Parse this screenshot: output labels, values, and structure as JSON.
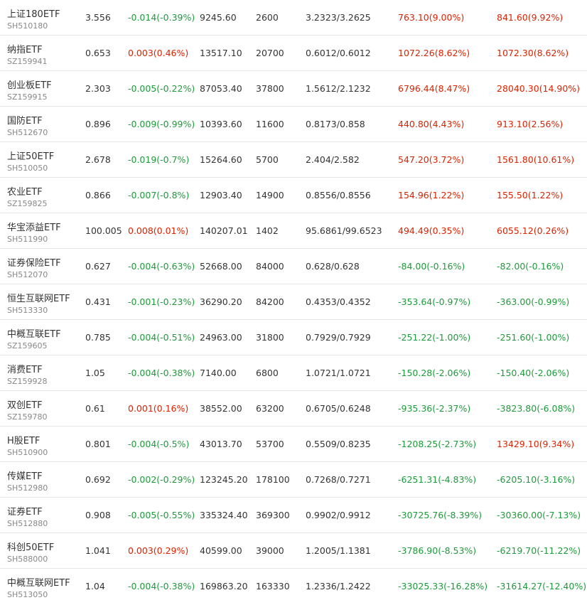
{
  "colors": {
    "up": "#dd2200",
    "down": "#1e9b3a",
    "text": "#333333",
    "code": "#888888"
  },
  "rows": [
    {
      "name": "上证180ETF",
      "code": "SH510180",
      "price": "3.556",
      "change": "-0.014(-0.39%)",
      "change_dir": "down",
      "amount": "9245.60",
      "volume": "2600",
      "range": "3.2323/3.2625",
      "flow1": "763.10(9.00%)",
      "flow1_dir": "up",
      "flow2": "841.60(9.92%)",
      "flow2_dir": "up"
    },
    {
      "name": "纳指ETF",
      "code": "SZ159941",
      "price": "0.653",
      "change": "0.003(0.46%)",
      "change_dir": "up",
      "amount": "13517.10",
      "volume": "20700",
      "range": "0.6012/0.6012",
      "flow1": "1072.26(8.62%)",
      "flow1_dir": "up",
      "flow2": "1072.30(8.62%)",
      "flow2_dir": "up"
    },
    {
      "name": "创业板ETF",
      "code": "SZ159915",
      "price": "2.303",
      "change": "-0.005(-0.22%)",
      "change_dir": "down",
      "amount": "87053.40",
      "volume": "37800",
      "range": "1.5612/2.1232",
      "flow1": "6796.44(8.47%)",
      "flow1_dir": "up",
      "flow2": "28040.30(14.90%)",
      "flow2_dir": "up"
    },
    {
      "name": "国防ETF",
      "code": "SH512670",
      "price": "0.896",
      "change": "-0.009(-0.99%)",
      "change_dir": "down",
      "amount": "10393.60",
      "volume": "11600",
      "range": "0.8173/0.858",
      "flow1": "440.80(4.43%)",
      "flow1_dir": "up",
      "flow2": "913.10(2.56%)",
      "flow2_dir": "up"
    },
    {
      "name": "上证50ETF",
      "code": "SH510050",
      "price": "2.678",
      "change": "-0.019(-0.7%)",
      "change_dir": "down",
      "amount": "15264.60",
      "volume": "5700",
      "range": "2.404/2.582",
      "flow1": "547.20(3.72%)",
      "flow1_dir": "up",
      "flow2": "1561.80(10.61%)",
      "flow2_dir": "up"
    },
    {
      "name": "农业ETF",
      "code": "SZ159825",
      "price": "0.866",
      "change": "-0.007(-0.8%)",
      "change_dir": "down",
      "amount": "12903.40",
      "volume": "14900",
      "range": "0.8556/0.8556",
      "flow1": "154.96(1.22%)",
      "flow1_dir": "up",
      "flow2": "155.50(1.22%)",
      "flow2_dir": "up"
    },
    {
      "name": "华宝添益ETF",
      "code": "SH511990",
      "price": "100.005",
      "change": "0.008(0.01%)",
      "change_dir": "up",
      "amount": "140207.01",
      "volume": "1402",
      "range": "95.6861/99.6523",
      "flow1": "494.49(0.35%)",
      "flow1_dir": "up",
      "flow2": "6055.12(0.26%)",
      "flow2_dir": "up"
    },
    {
      "name": "证券保险ETF",
      "code": "SH512070",
      "price": "0.627",
      "change": "-0.004(-0.63%)",
      "change_dir": "down",
      "amount": "52668.00",
      "volume": "84000",
      "range": "0.628/0.628",
      "flow1": "-84.00(-0.16%)",
      "flow1_dir": "down",
      "flow2": "-82.00(-0.16%)",
      "flow2_dir": "down"
    },
    {
      "name": "恒生互联网ETF",
      "code": "SH513330",
      "price": "0.431",
      "change": "-0.001(-0.23%)",
      "change_dir": "down",
      "amount": "36290.20",
      "volume": "84200",
      "range": "0.4353/0.4352",
      "flow1": "-353.64(-0.97%)",
      "flow1_dir": "down",
      "flow2": "-363.00(-0.99%)",
      "flow2_dir": "down"
    },
    {
      "name": "中概互联ETF",
      "code": "SZ159605",
      "price": "0.785",
      "change": "-0.004(-0.51%)",
      "change_dir": "down",
      "amount": "24963.00",
      "volume": "31800",
      "range": "0.7929/0.7929",
      "flow1": "-251.22(-1.00%)",
      "flow1_dir": "down",
      "flow2": "-251.60(-1.00%)",
      "flow2_dir": "down"
    },
    {
      "name": "消费ETF",
      "code": "SZ159928",
      "price": "1.05",
      "change": "-0.004(-0.38%)",
      "change_dir": "down",
      "amount": "7140.00",
      "volume": "6800",
      "range": "1.0721/1.0721",
      "flow1": "-150.28(-2.06%)",
      "flow1_dir": "down",
      "flow2": "-150.40(-2.06%)",
      "flow2_dir": "down"
    },
    {
      "name": "双创ETF",
      "code": "SZ159780",
      "price": "0.61",
      "change": "0.001(0.16%)",
      "change_dir": "up",
      "amount": "38552.00",
      "volume": "63200",
      "range": "0.6705/0.6248",
      "flow1": "-935.36(-2.37%)",
      "flow1_dir": "down",
      "flow2": "-3823.80(-6.08%)",
      "flow2_dir": "down"
    },
    {
      "name": "H股ETF",
      "code": "SH510900",
      "price": "0.801",
      "change": "-0.004(-0.5%)",
      "change_dir": "down",
      "amount": "43013.70",
      "volume": "53700",
      "range": "0.5509/0.8235",
      "flow1": "-1208.25(-2.73%)",
      "flow1_dir": "down",
      "flow2": "13429.10(9.34%)",
      "flow2_dir": "up"
    },
    {
      "name": "传媒ETF",
      "code": "SH512980",
      "price": "0.692",
      "change": "-0.002(-0.29%)",
      "change_dir": "down",
      "amount": "123245.20",
      "volume": "178100",
      "range": "0.7268/0.7271",
      "flow1": "-6251.31(-4.83%)",
      "flow1_dir": "down",
      "flow2": "-6205.10(-3.16%)",
      "flow2_dir": "down"
    },
    {
      "name": "证券ETF",
      "code": "SH512880",
      "price": "0.908",
      "change": "-0.005(-0.55%)",
      "change_dir": "down",
      "amount": "335324.40",
      "volume": "369300",
      "range": "0.9902/0.9912",
      "flow1": "-30725.76(-8.39%)",
      "flow1_dir": "down",
      "flow2": "-30360.00(-7.13%)",
      "flow2_dir": "down"
    },
    {
      "name": "科创50ETF",
      "code": "SH588000",
      "price": "1.041",
      "change": "0.003(0.29%)",
      "change_dir": "up",
      "amount": "40599.00",
      "volume": "39000",
      "range": "1.2005/1.1381",
      "flow1": "-3786.90(-8.53%)",
      "flow1_dir": "down",
      "flow2": "-6219.70(-11.22%)",
      "flow2_dir": "down"
    },
    {
      "name": "中概互联网ETF",
      "code": "SH513050",
      "price": "1.04",
      "change": "-0.004(-0.38%)",
      "change_dir": "down",
      "amount": "169863.20",
      "volume": "163330",
      "range": "1.2336/1.2422",
      "flow1": "-33025.33(-16.28%)",
      "flow1_dir": "down",
      "flow2": "-31614.27(-12.40%)",
      "flow2_dir": "down"
    }
  ]
}
